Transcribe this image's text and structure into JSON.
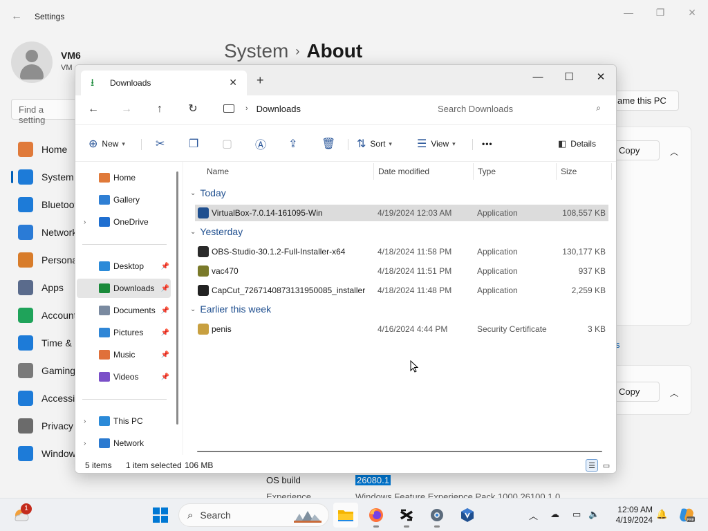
{
  "settings": {
    "title": "Settings",
    "user": {
      "name": "VM6",
      "sub": "VM"
    },
    "search_placeholder": "Find a setting",
    "breadcrumb": {
      "parent": "System",
      "separator": "›",
      "current": "About"
    },
    "nav": [
      {
        "label": "Home",
        "icon": "home-icon",
        "color": "#e07a3a"
      },
      {
        "label": "System",
        "icon": "monitor-icon",
        "color": "#1d7bd8",
        "active": true
      },
      {
        "label": "Bluetooth",
        "icon": "bluetooth-icon",
        "color": "#1d7bd8"
      },
      {
        "label": "Network",
        "icon": "wifi-icon",
        "color": "#2a7bd6"
      },
      {
        "label": "Personal",
        "icon": "brush-icon",
        "color": "#d87c2a"
      },
      {
        "label": "Apps",
        "icon": "apps-icon",
        "color": "#5a6b8c"
      },
      {
        "label": "Accounts",
        "icon": "person-icon",
        "color": "#1fa35a"
      },
      {
        "label": "Time &",
        "icon": "clock-icon",
        "color": "#1d7bd8"
      },
      {
        "label": "Gaming",
        "icon": "gamepad-icon",
        "color": "#7a7a7a"
      },
      {
        "label": "Accessib",
        "icon": "accessibility-icon",
        "color": "#1d7bd8"
      },
      {
        "label": "Privacy",
        "icon": "shield-icon",
        "color": "#6b6b6b"
      },
      {
        "label": "Window",
        "icon": "update-icon",
        "color": "#1d7bd8"
      }
    ],
    "rename_button": "ame this PC",
    "copy_button": "Copy",
    "copy_button_2": "Copy",
    "link_fragment": "s",
    "specs": {
      "os_build_label": "OS build",
      "os_build_value": "26080.1",
      "experience_label": "Experience",
      "experience_value": "Windows Feature Experience Pack 1000.26100.1.0"
    }
  },
  "explorer": {
    "tab_label": "Downloads",
    "tab_icon": "download-icon",
    "window_controls": {
      "minimize": "—",
      "maximize": "☐",
      "close": "✕"
    },
    "location": "Downloads",
    "search_placeholder": "Search Downloads",
    "toolbar": {
      "new_label": "New",
      "sort_label": "Sort",
      "view_label": "View",
      "more_label": "•••",
      "details_label": "Details"
    },
    "nav_pane": {
      "top": [
        {
          "label": "Home",
          "icon": "home-icon",
          "color": "#e07a3a"
        },
        {
          "label": "Gallery",
          "icon": "gallery-icon",
          "color": "#2f7fd4"
        },
        {
          "label": "OneDrive",
          "icon": "cloud-icon",
          "color": "#1f6fd0",
          "expandable": true
        }
      ],
      "quick": [
        {
          "label": "Desktop",
          "icon": "desktop-icon",
          "color": "#2b8ad8",
          "pinned": true
        },
        {
          "label": "Downloads",
          "icon": "download-icon",
          "color": "#1a8a3a",
          "pinned": true,
          "selected": true
        },
        {
          "label": "Documents",
          "icon": "document-icon",
          "color": "#7a8aa0",
          "pinned": true
        },
        {
          "label": "Pictures",
          "icon": "pictures-icon",
          "color": "#2f86d6",
          "pinned": true
        },
        {
          "label": "Music",
          "icon": "music-icon",
          "color": "#e0703a",
          "pinned": true
        },
        {
          "label": "Videos",
          "icon": "videos-icon",
          "color": "#7a4fc8",
          "pinned": true
        }
      ],
      "bottom": [
        {
          "label": "This PC",
          "icon": "pc-icon",
          "color": "#2b8ad8",
          "expandable": true
        },
        {
          "label": "Network",
          "icon": "network-icon",
          "color": "#2b7ad0",
          "expandable": true
        }
      ]
    },
    "columns": {
      "name": "Name",
      "date": "Date modified",
      "type": "Type",
      "size": "Size"
    },
    "groups": [
      {
        "label": "Today",
        "files": [
          {
            "name": "VirtualBox-7.0.14-161095-Win",
            "date": "4/19/2024 12:03 AM",
            "type": "Application",
            "size": "108,557 KB",
            "icon": "virtualbox-icon",
            "color": "#1f4f8f",
            "selected": true
          }
        ]
      },
      {
        "label": "Yesterday",
        "files": [
          {
            "name": "OBS-Studio-30.1.2-Full-Installer-x64",
            "date": "4/18/2024 11:58 PM",
            "type": "Application",
            "size": "130,177 KB",
            "icon": "obs-icon",
            "color": "#2a2a2a"
          },
          {
            "name": "vac470",
            "date": "4/18/2024 11:51 PM",
            "type": "Application",
            "size": "937 KB",
            "icon": "installer-icon",
            "color": "#7a7a2a"
          },
          {
            "name": "CapCut_7267140873131950085_installer",
            "date": "4/18/2024 11:48 PM",
            "type": "Application",
            "size": "2,259 KB",
            "icon": "capcut-icon",
            "color": "#222222"
          }
        ]
      },
      {
        "label": "Earlier this week",
        "files": [
          {
            "name": "penis",
            "date": "4/16/2024 4:44 PM",
            "type": "Security Certificate",
            "size": "3 KB",
            "icon": "certificate-icon",
            "color": "#c8a040"
          }
        ]
      }
    ],
    "status": {
      "count": "5 items",
      "selection": "1 item selected",
      "size": "106 MB"
    }
  },
  "taskbar": {
    "notification_count": "1",
    "search_label": "Search",
    "apps": [
      {
        "name": "file-explorer-icon",
        "active": true
      },
      {
        "name": "firefox-icon",
        "open": true
      },
      {
        "name": "capcut-app-icon",
        "open": true
      },
      {
        "name": "settings-app-icon",
        "open": true
      },
      {
        "name": "virtualbox-app-icon",
        "open": false
      }
    ],
    "time": "12:09 AM",
    "date": "4/19/2024",
    "accent": "#0078d4"
  }
}
